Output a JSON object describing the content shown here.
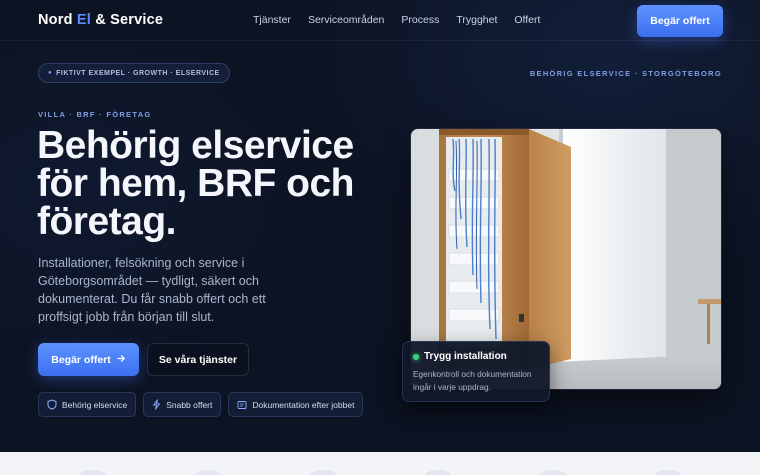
{
  "nav": {
    "brand_part1": "Nord ",
    "brand_accent": "El",
    "brand_part2": " & Service",
    "items": [
      "Tjänster",
      "Serviceområden",
      "Process",
      "Trygghet",
      "Offert"
    ],
    "cta": "Begär offert"
  },
  "hero": {
    "pill": "FIKTIVT EXEMPEL · GROWTH · ELSERVICE",
    "right_tag": "BEHÖRIG ELSERVICE · STORGÖTEBORG",
    "eyebrow": "VILLA · BRF · FÖRETAG",
    "headline": "Behörig elservice för hem, BRF och företag.",
    "lead": "Installationer, felsökning och service i Göteborgsområdet — tydligt, säkert och dokumenterat. Du får snabb offert och ett proffsigt jobb från början till slut.",
    "primary_cta": "Begär offert",
    "secondary_cta": "Se våra tjänster",
    "chips": [
      "Behörig elservice",
      "Snabb offert",
      "Dokumentation efter jobbet"
    ]
  },
  "trust_card": {
    "title": "Trygg installation",
    "body": "Egenkontroll och dokumentation ingår i varje uppdrag."
  },
  "colors": {
    "accent": "#4a7ff8",
    "background": "#0c1322",
    "status_green": "#3ad07a"
  }
}
